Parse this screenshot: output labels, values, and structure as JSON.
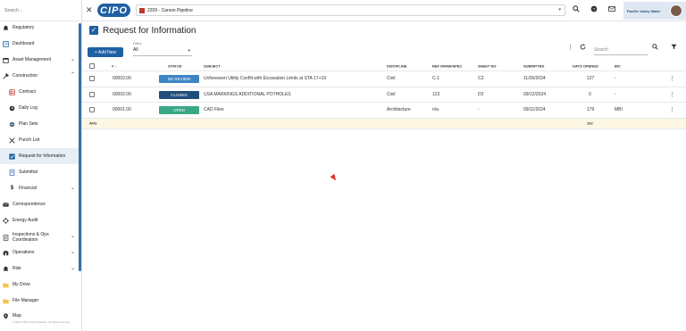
{
  "sidebar": {
    "search_placeholder": "Search...",
    "items": [
      {
        "label": "Regulatory",
        "icon": "bell-icon"
      },
      {
        "label": "Dashboard",
        "icon": "dashboard-icon"
      },
      {
        "label": "Asset Management",
        "icon": "box-icon"
      },
      {
        "label": "Construction",
        "icon": "tools-icon"
      },
      {
        "label": "Contract",
        "icon": "grid-icon"
      },
      {
        "label": "Daily Log",
        "icon": "clock-icon"
      },
      {
        "label": "Plan Sets",
        "icon": "globe-icon"
      },
      {
        "label": "Punch List",
        "icon": "wrench-icon"
      },
      {
        "label": "Request for Information",
        "icon": "check-icon"
      },
      {
        "label": "Submittal",
        "icon": "doc-icon"
      },
      {
        "label": "Financial",
        "icon": "dollar-icon"
      },
      {
        "label": "Correspondence",
        "icon": "mail-icon"
      },
      {
        "label": "Energy Audit",
        "icon": "energy-icon"
      },
      {
        "label": "Inspections & Ops",
        "label2": "Coordination",
        "icon": "list-icon"
      },
      {
        "label": "Operations",
        "icon": "building-icon"
      },
      {
        "label": "Risk",
        "icon": "risk-icon"
      },
      {
        "label": "My Drive",
        "icon": "folder-icon"
      },
      {
        "label": "File Manager",
        "icon": "folder-icon"
      },
      {
        "label": "Map",
        "icon": "map-pin-icon"
      }
    ],
    "footer": "© 2024 CIPO Cloud Software. All rights reserved."
  },
  "topbar": {
    "logo": "CIPO",
    "project": "2209 - Carson Pipeline",
    "brand": "Pacific Valley Water"
  },
  "page": {
    "title": "Request for Information",
    "add_new": "+ Add New",
    "filters_label": "Filters",
    "filter_value": "All",
    "search_placeholder": "Search"
  },
  "table": {
    "headers": {
      "num": "# ↓",
      "status": "STATUS",
      "subject": "SUBJECT",
      "discipline": "DISCIPLINE",
      "ref": "REF DRAW/SPEC",
      "sheet": "SHEET NO",
      "submitted": "SUBMITTED",
      "days": "DAYS OPENED",
      "bic": "BIC"
    },
    "rows": [
      {
        "num": "00003.00",
        "status": "DE REVIEW",
        "status_color": "#3d84c6",
        "subject": "Unforeseen Utility Conflit with Excavation Limits at STA 17+19",
        "discipline": "Civil",
        "ref": "C-1",
        "sheet": "C3",
        "submitted": "11/26/2024",
        "days": "127",
        "bic": "-"
      },
      {
        "num": "00002.00",
        "status": "CLOSED",
        "status_color": "#1f4e7a",
        "subject": "USA MARKINGS ADDITIONAL POTHOLES",
        "discipline": "Civil",
        "ref": "123",
        "sheet": "D2",
        "submitted": "09/12/2024",
        "days": "0",
        "bic": "-"
      },
      {
        "num": "00001.00",
        "status": "OPEN",
        "status_color": "#3aa886",
        "subject": "CAD Files",
        "discipline": "Architecture",
        "ref": "n/a",
        "sheet": "-",
        "submitted": "09/11/2024",
        "days": "179",
        "bic": "MBI"
      }
    ],
    "avg_label": "AVG",
    "avg_days": "102"
  }
}
